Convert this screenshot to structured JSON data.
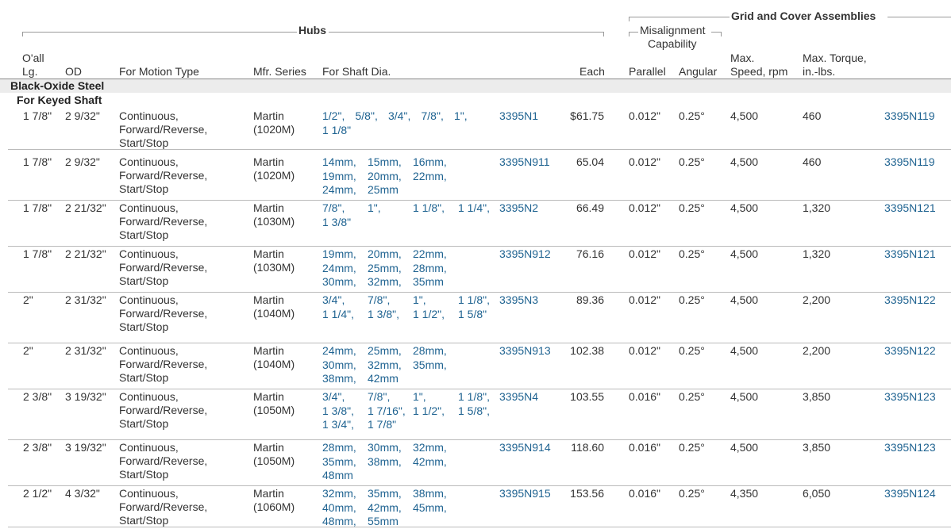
{
  "headers": {
    "hubs_group": "Hubs",
    "grid_group": "Grid and Cover Assemblies",
    "misalign_line1": "Misalignment",
    "misalign_line2": "Capability",
    "oall_line1": "O'all",
    "oall_line2": "Lg.",
    "od": "OD",
    "motion": "For Motion Type",
    "mfr": "Mfr. Series",
    "shaft": "For Shaft Dia.",
    "each": "Each",
    "parallel": "Parallel",
    "angular": "Angular",
    "speed_line1": "Max.",
    "speed_line2": "Speed, rpm",
    "torque_line1": "Max. Torque,",
    "torque_line2": "in.-lbs."
  },
  "section": {
    "title": "Black-Oxide Steel",
    "subtitle": "For Keyed Shaft"
  },
  "rows": [
    {
      "oall": "1 7/8\"",
      "od": "2 9/32\"",
      "motion": [
        "Continuous,",
        "Forward/Reverse,",
        "Start/Stop"
      ],
      "mfr": [
        "Martin",
        "(1020M)"
      ],
      "shaft": [
        "1/2\"",
        "5/8\"",
        "3/4\"",
        "7/8\"",
        "1\"",
        "1 1/8\""
      ],
      "part": "3395N1",
      "each": "$61.75",
      "parallel": "0.012\"",
      "angular": "0.25°",
      "speed": "4,500",
      "torque": "460",
      "grid_part": "3395N119"
    },
    {
      "oall": "1 7/8\"",
      "od": "2 9/32\"",
      "motion": [
        "Continuous,",
        "Forward/Reverse,",
        "Start/Stop"
      ],
      "mfr": [
        "Martin",
        "(1020M)"
      ],
      "shaft": [
        "14mm",
        "15mm",
        "16mm",
        "19mm",
        "20mm",
        "22mm",
        "24mm",
        "25mm"
      ],
      "part": "3395N911",
      "each": "65.04",
      "parallel": "0.012\"",
      "angular": "0.25°",
      "speed": "4,500",
      "torque": "460",
      "grid_part": "3395N119"
    },
    {
      "oall": "1 7/8\"",
      "od": "2 21/32\"",
      "motion": [
        "Continuous,",
        "Forward/Reverse,",
        "Start/Stop"
      ],
      "mfr": [
        "Martin",
        "(1030M)"
      ],
      "shaft": [
        "7/8\"",
        "1\"",
        "1 1/8\"",
        "1 1/4\"",
        "1 3/8\""
      ],
      "part": "3395N2",
      "each": "66.49",
      "parallel": "0.012\"",
      "angular": "0.25°",
      "speed": "4,500",
      "torque": "1,320",
      "grid_part": "3395N121"
    },
    {
      "oall": "1 7/8\"",
      "od": "2 21/32\"",
      "motion": [
        "Continuous,",
        "Forward/Reverse,",
        "Start/Stop"
      ],
      "mfr": [
        "Martin",
        "(1030M)"
      ],
      "shaft": [
        "19mm",
        "20mm",
        "22mm",
        "24mm",
        "25mm",
        "28mm",
        "30mm",
        "32mm",
        "35mm"
      ],
      "part": "3395N912",
      "each": "76.16",
      "parallel": "0.012\"",
      "angular": "0.25°",
      "speed": "4,500",
      "torque": "1,320",
      "grid_part": "3395N121"
    },
    {
      "oall": "2\"",
      "od": "2 31/32\"",
      "motion": [
        "Continuous,",
        "Forward/Reverse,",
        "Start/Stop"
      ],
      "mfr": [
        "Martin",
        "(1040M)"
      ],
      "shaft": [
        "3/4\"",
        "7/8\"",
        "1\"",
        "1 1/8\"",
        "1 1/4\"",
        "1 3/8\"",
        "1 1/2\"",
        "1 5/8\""
      ],
      "part": "3395N3",
      "each": "89.36",
      "parallel": "0.012\"",
      "angular": "0.25°",
      "speed": "4,500",
      "torque": "2,200",
      "grid_part": "3395N122"
    },
    {
      "oall": "2\"",
      "od": "2 31/32\"",
      "motion": [
        "Continuous,",
        "Forward/Reverse,",
        "Start/Stop"
      ],
      "mfr": [
        "Martin",
        "(1040M)"
      ],
      "shaft": [
        "24mm",
        "25mm",
        "28mm",
        "30mm",
        "32mm",
        "35mm",
        "38mm",
        "42mm"
      ],
      "part": "3395N913",
      "each": "102.38",
      "parallel": "0.012\"",
      "angular": "0.25°",
      "speed": "4,500",
      "torque": "2,200",
      "grid_part": "3395N122"
    },
    {
      "oall": "2 3/8\"",
      "od": "3 19/32\"",
      "motion": [
        "Continuous,",
        "Forward/Reverse,",
        "Start/Stop"
      ],
      "mfr": [
        "Martin",
        "(1050M)"
      ],
      "shaft": [
        "3/4\"",
        "7/8\"",
        "1\"",
        "1 1/8\"",
        "1 3/8\"",
        "1 7/16\"",
        "1 1/2\"",
        "1 5/8\"",
        "1 3/4\"",
        "1 7/8\""
      ],
      "part": "3395N4",
      "each": "103.55",
      "parallel": "0.016\"",
      "angular": "0.25°",
      "speed": "4,500",
      "torque": "3,850",
      "grid_part": "3395N123"
    },
    {
      "oall": "2 3/8\"",
      "od": "3 19/32\"",
      "motion": [
        "Continuous,",
        "Forward/Reverse,",
        "Start/Stop"
      ],
      "mfr": [
        "Martin",
        "(1050M)"
      ],
      "shaft": [
        "28mm",
        "30mm",
        "32mm",
        "35mm",
        "38mm",
        "42mm",
        "48mm"
      ],
      "part": "3395N914",
      "each": "118.60",
      "parallel": "0.016\"",
      "angular": "0.25°",
      "speed": "4,500",
      "torque": "3,850",
      "grid_part": "3395N123"
    },
    {
      "oall": "2 1/2\"",
      "od": "4 3/32\"",
      "motion": [
        "Continuous,",
        "Forward/Reverse,",
        "Start/Stop"
      ],
      "mfr": [
        "Martin",
        "(1060M)"
      ],
      "shaft": [
        "32mm",
        "35mm",
        "38mm",
        "40mm",
        "42mm",
        "45mm",
        "48mm",
        "55mm"
      ],
      "part": "3395N915",
      "each": "153.56",
      "parallel": "0.016\"",
      "angular": "0.25°",
      "speed": "4,350",
      "torque": "6,050",
      "grid_part": "3395N124"
    }
  ]
}
